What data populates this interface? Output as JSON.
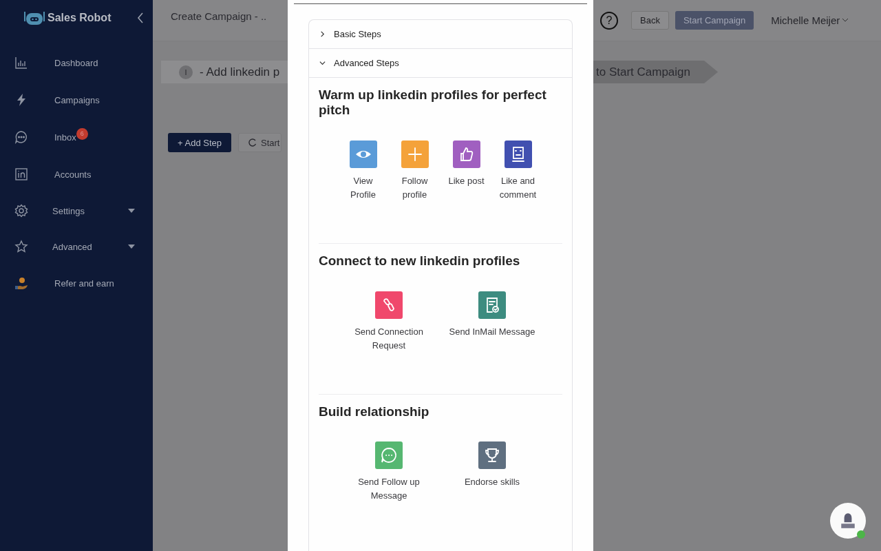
{
  "sidebar": {
    "brand": "Sales Robot",
    "items": [
      {
        "label": "Dashboard",
        "kind": "link"
      },
      {
        "label": "Campaigns",
        "kind": "link"
      },
      {
        "label": "Inbox",
        "kind": "link",
        "badge": "6"
      },
      {
        "label": "Accounts",
        "kind": "link"
      },
      {
        "label": "Settings",
        "kind": "group",
        "expanded": false
      },
      {
        "label": "Advanced",
        "kind": "group",
        "expanded": false
      },
      {
        "label": "Refer and earn",
        "kind": "link"
      }
    ]
  },
  "header": {
    "title": "Create Campaign - ..",
    "help": "?",
    "buttons": [
      {
        "label": "Back",
        "kind": "secondary"
      },
      {
        "label": "Start Campaign",
        "kind": "primary"
      }
    ],
    "user": "Michelle Meijer"
  },
  "stepper": {
    "step_number": "I",
    "left_text": "- Add linkedin p",
    "right_text": "to Start Campaign"
  },
  "actions": [
    {
      "label": "+ Add Step",
      "kind": "primary"
    },
    {
      "label": "Start",
      "kind": "secondary"
    }
  ],
  "panel": {
    "accordion": [
      {
        "label": "Basic Steps",
        "expanded": false
      },
      {
        "label": "Advanced Steps",
        "expanded": true,
        "sections": [
          {
            "title": "Warm up linkedin profiles for perfect pitch",
            "items": [
              {
                "label": "View Profile",
                "color": "#5a9bd8"
              },
              {
                "label": "Follow profile",
                "color": "#f4a23a"
              },
              {
                "label": "Like post",
                "color": "#a05fc0"
              },
              {
                "label": "Like and comment",
                "color": "#4150b0"
              }
            ]
          },
          {
            "title": "Connect to new linkedin profiles",
            "items": [
              {
                "label": "Send Connection Request",
                "color": "#f0486c"
              },
              {
                "label": "Send InMail Message",
                "color": "#3d8c80"
              }
            ]
          },
          {
            "title": "Build relationship",
            "items": [
              {
                "label": "Send Follow up Message",
                "color": "#56b771"
              },
              {
                "label": "Endorse skills",
                "color": "#5f6f80"
              }
            ]
          }
        ]
      }
    ]
  },
  "chat": {
    "online": true
  }
}
